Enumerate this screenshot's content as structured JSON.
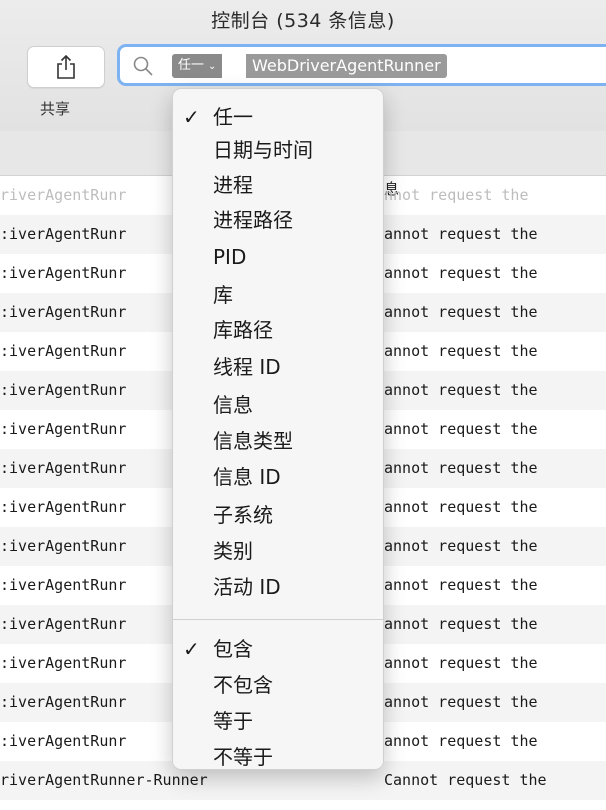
{
  "window": {
    "title": "控制台 (534 条信息)"
  },
  "toolbar": {
    "share_label": "共享"
  },
  "search": {
    "field_type": "任一",
    "field_value": "WebDriverAgentRunner"
  },
  "log": {
    "header_partial": "息",
    "rows": [
      {
        "col1": "riverAgentRunr",
        "col2": "nnot request the"
      },
      {
        "col1": ":iverAgentRunr",
        "col2": "annot request the"
      },
      {
        "col1": ":iverAgentRunr",
        "col2": "annot request the"
      },
      {
        "col1": ":iverAgentRunr",
        "col2": "annot request the"
      },
      {
        "col1": ":iverAgentRunr",
        "col2": "annot request the"
      },
      {
        "col1": ":iverAgentRunr",
        "col2": "annot request the"
      },
      {
        "col1": ":iverAgentRunr",
        "col2": "annot request the"
      },
      {
        "col1": ":iverAgentRunr",
        "col2": "annot request the"
      },
      {
        "col1": ":iverAgentRunr",
        "col2": "annot request the"
      },
      {
        "col1": ":iverAgentRunr",
        "col2": "annot request the"
      },
      {
        "col1": ":iverAgentRunr",
        "col2": "annot request the"
      },
      {
        "col1": ":iverAgentRunr",
        "col2": "annot request the"
      },
      {
        "col1": ":iverAgentRunr",
        "col2": "annot request the"
      },
      {
        "col1": ":iverAgentRunr",
        "col2": "annot request the"
      },
      {
        "col1": ":iverAgentRunr",
        "col2": "annot request the"
      },
      {
        "col1": "riverAgentRunner-Runner",
        "col2": "Cannot request the"
      }
    ]
  },
  "menu": {
    "fields": [
      {
        "label": "任一",
        "checked": "✓"
      },
      {
        "label": "日期与时间",
        "checked": ""
      },
      {
        "label": "进程",
        "checked": ""
      },
      {
        "label": "进程路径",
        "checked": ""
      },
      {
        "label": "PID",
        "checked": ""
      },
      {
        "label": "库",
        "checked": ""
      },
      {
        "label": "库路径",
        "checked": ""
      },
      {
        "label": "线程 ID",
        "checked": ""
      },
      {
        "label": "信息",
        "checked": ""
      },
      {
        "label": "信息类型",
        "checked": ""
      },
      {
        "label": "信息 ID",
        "checked": ""
      },
      {
        "label": "子系统",
        "checked": ""
      },
      {
        "label": "类别",
        "checked": ""
      },
      {
        "label": "活动 ID",
        "checked": ""
      }
    ],
    "operators": [
      {
        "label": "包含",
        "checked": "✓"
      },
      {
        "label": "不包含",
        "checked": ""
      },
      {
        "label": "等于",
        "checked": ""
      },
      {
        "label": "不等于",
        "checked": ""
      }
    ]
  }
}
